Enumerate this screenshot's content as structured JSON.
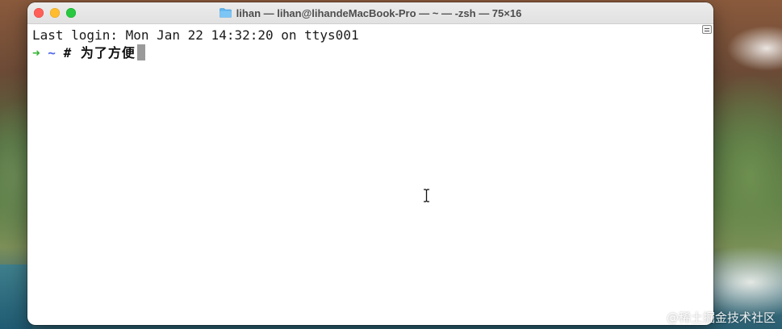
{
  "window": {
    "title": "lihan — lihan@lihandeMacBook-Pro — ~ — -zsh — 75×16",
    "folder_icon": "folder-icon",
    "controls": {
      "close": "close-button",
      "minimize": "minimize-button",
      "zoom": "zoom-button"
    }
  },
  "terminal": {
    "last_login": "Last login: Mon Jan 22 14:32:20 on ttys001",
    "prompt_arrow": "➜",
    "prompt_dir": "~",
    "input": "# 为了方便",
    "prompt_arrow_color": "#2fb42f",
    "prompt_dir_color": "#4f67e8"
  },
  "watermark": "@稀土掘金技术社区",
  "colors": {
    "close": "#ff5f57",
    "minimize": "#febc2e",
    "zoom": "#28c840"
  }
}
